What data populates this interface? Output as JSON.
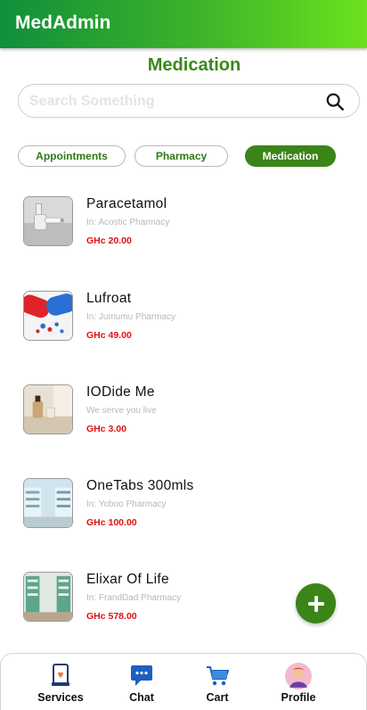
{
  "app": {
    "title": "MedAdmin"
  },
  "page": {
    "title": "Medication"
  },
  "search": {
    "placeholder": "Search Something",
    "value": "",
    "icon": "search-icon"
  },
  "tabs": [
    {
      "label": "Appointments",
      "active": false
    },
    {
      "label": "Pharmacy",
      "active": false
    },
    {
      "label": "Medication",
      "active": true
    }
  ],
  "medications": [
    {
      "name": "Paracetamol",
      "subtitle": "In: Acostic Pharmacy",
      "price": "GHc 20.00"
    },
    {
      "name": "Lufroat",
      "subtitle": "In: Jumumu Pharmacy",
      "price": "GHc 49.00"
    },
    {
      "name": "IODide Me",
      "subtitle": "We serve you live",
      "price": "GHc 3.00"
    },
    {
      "name": "OneTabs 300mls",
      "subtitle": "In: Yoboo Pharmacy",
      "price": "GHc 100.00"
    },
    {
      "name": "Elixar Of Life",
      "subtitle": "In: FrandDad Pharmacy",
      "price": "GHc 578.00"
    }
  ],
  "fab": {
    "icon": "plus-icon"
  },
  "nav": [
    {
      "label": "Services",
      "icon": "services-icon"
    },
    {
      "label": "Chat",
      "icon": "chat-icon"
    },
    {
      "label": "Cart",
      "icon": "cart-icon"
    },
    {
      "label": "Profile",
      "icon": "profile-avatar-icon"
    }
  ],
  "colors": {
    "primary": "#3b8418",
    "appbar_start": "#0f8f3a",
    "appbar_end": "#6be21c",
    "price": "#e01010",
    "subtitle": "#b8b8b8"
  }
}
